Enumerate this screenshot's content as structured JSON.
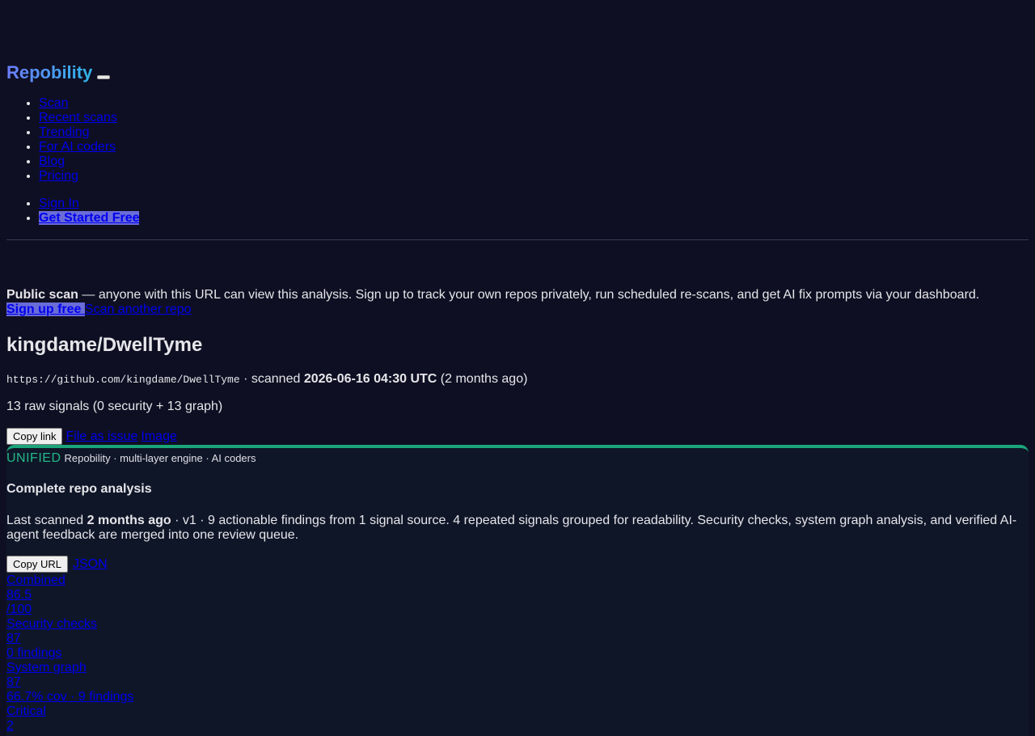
{
  "header": {
    "brand": "Repobility",
    "nav": [
      {
        "label": "Scan"
      },
      {
        "label": "Recent scans"
      },
      {
        "label": "Trending"
      },
      {
        "label": "For AI coders"
      },
      {
        "label": "Blog"
      },
      {
        "label": "Pricing"
      }
    ],
    "auth": {
      "sign_in": "Sign In",
      "get_started": "Get Started Free"
    }
  },
  "notice": {
    "bold": "Public scan",
    "text": " — anyone with this URL can view this analysis. Sign up to track your own repos privately, run scheduled re-scans, and get AI fix prompts via your dashboard.",
    "signup": "Sign up free",
    "scan_another": "Scan another repo"
  },
  "repo": {
    "name": "kingdame/DwellTyme",
    "url": "https://github.com/kingdame/DwellTyme",
    "scanned_prefix": " · scanned ",
    "scanned_at": "2026-06-16 04:30 UTC",
    "scanned_ago": " (2 months ago)",
    "signals": "13 raw signals (0 security + 13 graph)",
    "copy_link": "Copy link",
    "file_issue": "File as issue",
    "image": "Image"
  },
  "card": {
    "tag": "UNIFIED",
    "engine": "Repobility · multi-layer engine · AI coders",
    "title": "Complete repo analysis",
    "desc_prefix": "Last scanned ",
    "desc_ago": "2 months ago",
    "desc_rest": " · v1 · 9 actionable findings from 1 signal source. 4 repeated signals grouped for readability. Security checks, system graph analysis, and verified AI-agent feedback are merged into one review queue.",
    "copy_url": "Copy URL",
    "json": "JSON",
    "scores": [
      {
        "label": "Combined",
        "value": "86.5",
        "sub": "/100"
      },
      {
        "label": "Security checks",
        "value": "87",
        "sub": "0 findings"
      },
      {
        "label": "System graph",
        "value": "87",
        "sub": "66.7% cov · 9 findings"
      },
      {
        "label": "Critical",
        "value": "2",
        "sub": ""
      }
    ]
  }
}
